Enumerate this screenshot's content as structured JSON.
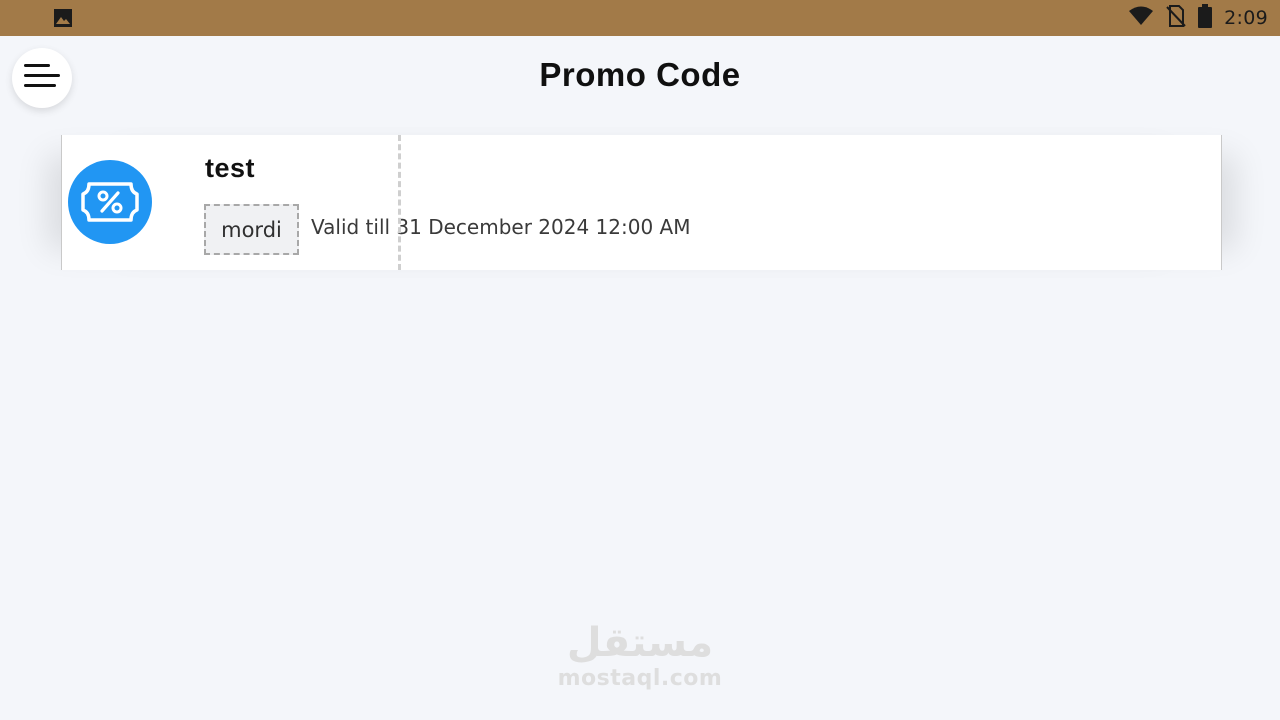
{
  "status_bar": {
    "time": "2:09",
    "icons": [
      "gallery-icon",
      "wifi-icon",
      "no-sim-icon",
      "battery-icon"
    ]
  },
  "header": {
    "title": "Promo Code",
    "menu_icon": "hamburger-menu-icon"
  },
  "promo_list": [
    {
      "title": "test",
      "code": "mordi",
      "validity": "Valid till 31 December 2024 12:00 AM",
      "icon": "percent-ticket-icon",
      "icon_color": "#2196f3"
    }
  ],
  "watermark": {
    "logo_text": "مستقل",
    "url": "mostaql.com"
  },
  "colors": {
    "status_bar": "#a27a48",
    "background": "#f4f6fa",
    "accent": "#2196f3"
  }
}
